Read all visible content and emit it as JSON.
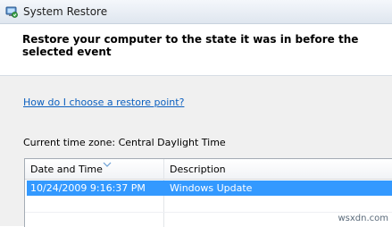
{
  "window": {
    "title": "System Restore",
    "icon": "system-restore-icon"
  },
  "header": {
    "title": "Restore your computer to the state it was in before the selected event"
  },
  "help_link": "How do I choose a restore point?",
  "timezone": "Current time zone: Central Daylight Time",
  "table": {
    "columns": [
      "Date and Time",
      "Description"
    ],
    "rows": [
      {
        "date_time": "10/24/2009 9:16:37 PM",
        "description": "Windows Update",
        "selected": true
      }
    ],
    "selection_color": "#3399ff"
  },
  "watermark": "wsxdn.com"
}
